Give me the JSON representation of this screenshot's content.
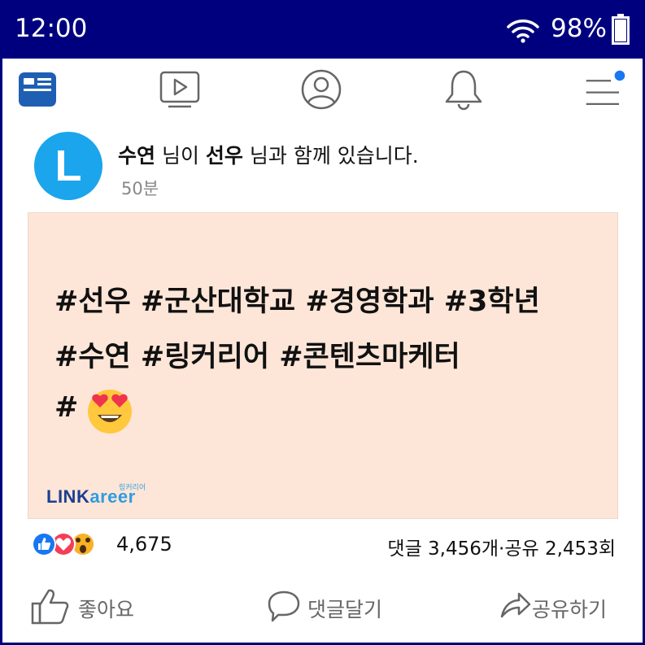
{
  "status_bar": {
    "time": "12:00",
    "battery": "98%"
  },
  "nav": {
    "icons": [
      "news-feed-icon",
      "video-icon",
      "profile-icon",
      "bell-icon",
      "menu-icon"
    ],
    "accent": "#1877f2"
  },
  "post": {
    "avatar_letter": "L",
    "author": "수연",
    "text_1": " 님이 ",
    "tagged": "선우",
    "text_2": " 님과 함께 있습니다.",
    "time_ago": "50분",
    "image": {
      "lines": [
        "#선우 #군산대학교 #경영학과 #3학년",
        "#수연 #링커리어 #콘텐츠마케터",
        "#"
      ],
      "emoji": "heart-eyes-emoji",
      "brand_small": "링커리어",
      "brand_part1": "LINK",
      "brand_part2": "areer",
      "background": "#fde6d8"
    },
    "reaction_count": "4,675",
    "comments_shares": "댓글 3,456개·공유 2,453회",
    "actions": {
      "like": "좋아요",
      "comment": "댓글달기",
      "share": "공유하기"
    }
  }
}
